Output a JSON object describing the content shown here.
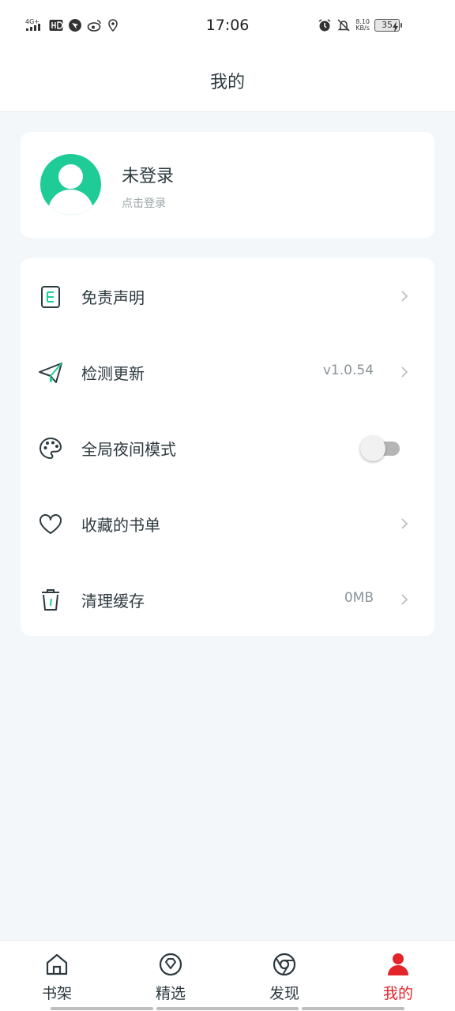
{
  "status_bar": {
    "network": "4G+",
    "time": "17:06",
    "net_speed_value": "8.10",
    "net_speed_unit": "KB/s",
    "battery": "35"
  },
  "header": {
    "title": "我的"
  },
  "profile": {
    "name": "未登录",
    "hint": "点击登录"
  },
  "menu": {
    "disclaimer": {
      "label": "免责声明"
    },
    "check_update": {
      "label": "检测更新",
      "value": "v1.0.54"
    },
    "night_mode": {
      "label": "全局夜间模式",
      "enabled": false
    },
    "saved_booklists": {
      "label": "收藏的书单"
    },
    "clear_cache": {
      "label": "清理缓存",
      "value": "0MB"
    }
  },
  "tabs": [
    {
      "label": "书架",
      "icon": "home-icon",
      "active": false
    },
    {
      "label": "精选",
      "icon": "diamond-icon",
      "active": false
    },
    {
      "label": "发现",
      "icon": "discover-icon",
      "active": false
    },
    {
      "label": "我的",
      "icon": "user-icon",
      "active": true
    }
  ],
  "colors": {
    "accent_green": "#1fcc98",
    "active_tab": "#e3242b",
    "page_bg": "#f3f7f9"
  }
}
